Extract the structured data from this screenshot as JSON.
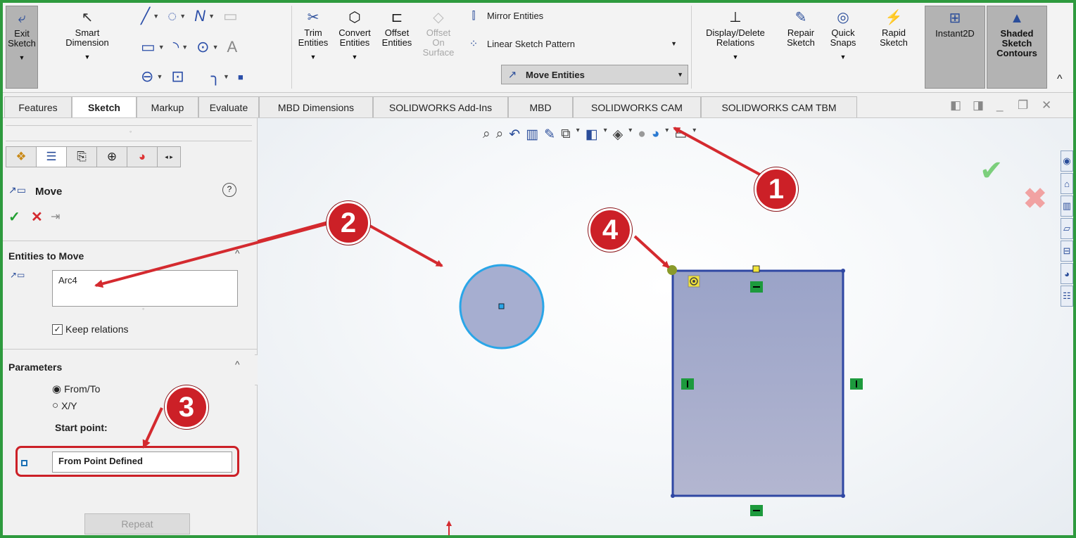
{
  "ribbon": {
    "exit_sketch": "Exit\nSketch",
    "smart_dimension": "Smart\nDimension",
    "trim": "Trim\nEntities",
    "convert": "Convert\nEntities",
    "offset": "Offset\nEntities",
    "offset_surface": "Offset\nOn\nSurface",
    "mirror": "Mirror Entities",
    "linear_pattern": "Linear Sketch Pattern",
    "move": "Move Entities",
    "display_delete": "Display/Delete\nRelations",
    "repair": "Repair\nSketch",
    "quick_snaps": "Quick\nSnaps",
    "rapid_sketch": "Rapid\nSketch",
    "instant2d": "Instant2D",
    "shaded": "Shaded\nSketch\nContours"
  },
  "tabs": [
    "Features",
    "Sketch",
    "Markup",
    "Evaluate",
    "MBD Dimensions",
    "SOLIDWORKS Add-Ins",
    "MBD",
    "SOLIDWORKS CAM",
    "SOLIDWORKS CAM TBM"
  ],
  "panel": {
    "title": "Move",
    "entities_header": "Entities to Move",
    "entity_value": "Arc4",
    "keep_relations": "Keep relations",
    "parameters_header": "Parameters",
    "option_from_to": "From/To",
    "option_xy": "X/Y",
    "start_point_label": "Start point:",
    "start_point_value": "From Point Defined",
    "repeat": "Repeat"
  },
  "markers": [
    "1",
    "2",
    "3",
    "4"
  ],
  "colors": {
    "accent_green": "#2e9a3e",
    "marker_red": "#cc2027",
    "arrow_red": "#d42a2f",
    "sketch_blue": "#2f47a3",
    "circle_blue": "#2aa6e8"
  },
  "icons": {
    "ok": "check-icon",
    "cancel": "close-icon",
    "pin": "pin-icon",
    "help": "help-icon"
  }
}
